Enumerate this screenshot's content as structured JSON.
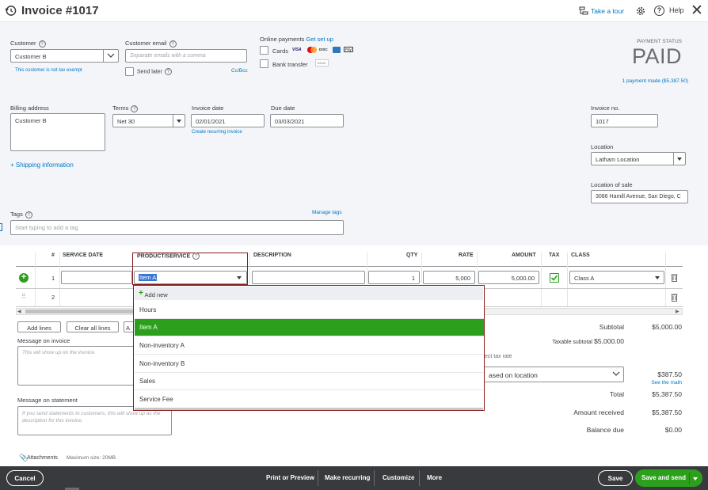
{
  "header": {
    "title": "Invoice #1017",
    "take_tour": "Take a tour",
    "help": "Help"
  },
  "customer": {
    "label": "Customer",
    "value": "Customer B",
    "tax_note": "This customer is not tax exempt"
  },
  "email": {
    "label": "Customer email",
    "placeholder": "Separate emails with a comma",
    "send_later": "Send later",
    "cc_bcc": "Cc/Bcc"
  },
  "online_payments": {
    "label": "Online payments",
    "get_set_up": "Get set up",
    "cards": "Cards",
    "bank_transfer": "Bank transfer",
    "card_badges": [
      "VISA",
      "MC",
      "DISC",
      "AMEX",
      "Pay"
    ],
    "bank_badge": "BANK"
  },
  "status": {
    "label": "PAYMENT STATUS",
    "value": "PAID",
    "payments_link": "1 payment made ($5,387.50)"
  },
  "billing": {
    "label": "Billing address",
    "value": "Customer B"
  },
  "terms": {
    "label": "Terms",
    "value": "Net 30"
  },
  "invoice_date": {
    "label": "Invoice date",
    "value": "02/01/2021",
    "recurring_link": "Create recurring invoice"
  },
  "due_date": {
    "label": "Due date",
    "value": "03/03/2021"
  },
  "shipping_link": "+ Shipping information",
  "invoice_no": {
    "label": "Invoice no.",
    "value": "1017"
  },
  "location": {
    "label": "Location",
    "value": "Latham Location"
  },
  "location_of_sale": {
    "label": "Location of sale",
    "value": "3086 Hamill Avenue, San Diego, C"
  },
  "tags": {
    "label": "Tags",
    "manage": "Manage tags",
    "placeholder": "Start typing to add a tag"
  },
  "table": {
    "headers": [
      "#",
      "SERVICE DATE",
      "PRODUCT/SERVICE",
      "DESCRIPTION",
      "QTY",
      "RATE",
      "AMOUNT",
      "TAX",
      "CLASS"
    ],
    "rows": [
      {
        "num": "1",
        "product": "Item A",
        "qty": "1",
        "rate": "5,000",
        "amount": "5,000.00",
        "class": "Class A"
      },
      {
        "num": "2"
      }
    ]
  },
  "dropdown": {
    "add_new": "Add new",
    "items": [
      "Hours",
      "Item A",
      "Non-inventory A",
      "Non-inventory B",
      "Sales",
      "Service Fee"
    ],
    "selected_index": 1
  },
  "line_buttons": {
    "add_lines": "Add lines",
    "clear_all": "Clear all lines",
    "partial": "A"
  },
  "message_invoice": {
    "label": "Message on invoice",
    "placeholder": "This will show up on the invoice."
  },
  "message_statement": {
    "label": "Message on statement",
    "placeholder": "If you send statements to customers, this will show up as the description for this invoice."
  },
  "attachments": {
    "label": "Attachments",
    "max": "Maximum size: 20MB"
  },
  "totals": {
    "subtotal_label": "Subtotal",
    "subtotal_value": "$5,000.00",
    "taxable_subtotal_label": "Taxable subtotal",
    "taxable_subtotal_value": "$5,000.00",
    "tax_rate_partial": "ect tax rate",
    "tax_select": "ased on location",
    "tax_value": "$387.50",
    "see_math": "See the math",
    "total_label": "Total",
    "total_value": "$5,387.50",
    "received_label": "Amount received",
    "received_value": "$5,387.50",
    "balance_label": "Balance due",
    "balance_value": "$0.00"
  },
  "footer": {
    "cancel": "Cancel",
    "print_preview": "Print or Preview",
    "make_recurring": "Make recurring",
    "customize": "Customize",
    "more": "More",
    "save": "Save",
    "save_send": "Save and send"
  },
  "colors": {
    "accent_green": "#2ca01c",
    "link_blue": "#0077c5",
    "highlight_red": "#8b1a1a",
    "footer_dark": "#393a3d"
  }
}
